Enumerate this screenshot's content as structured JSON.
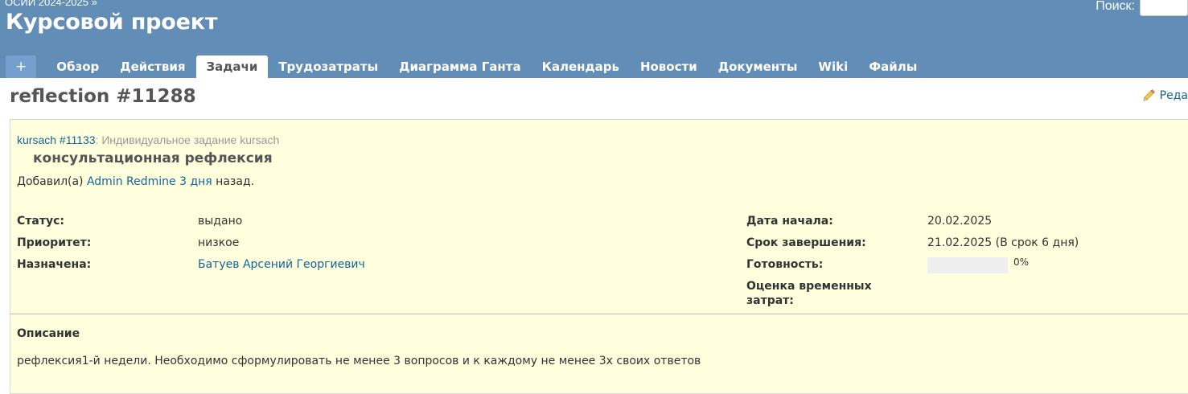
{
  "header": {
    "parent_project": "ОСИИ 2024-2025 »",
    "project_title": "Курсовой проект",
    "search_label": "Поиск:",
    "search_value": ""
  },
  "tabs": [
    {
      "label": "+",
      "selected": false
    },
    {
      "label": "Обзор",
      "selected": false
    },
    {
      "label": "Действия",
      "selected": false
    },
    {
      "label": "Задачи",
      "selected": true
    },
    {
      "label": "Трудозатраты",
      "selected": false
    },
    {
      "label": "Диаграмма Ганта",
      "selected": false
    },
    {
      "label": "Календарь",
      "selected": false
    },
    {
      "label": "Новости",
      "selected": false
    },
    {
      "label": "Документы",
      "selected": false
    },
    {
      "label": "Wiki",
      "selected": false
    },
    {
      "label": "Файлы",
      "selected": false
    }
  ],
  "issue": {
    "title": "reflection #11288",
    "edit_label": "Реда",
    "edit_icon": "pencil-icon",
    "parent_link": "kursach #11133",
    "parent_suffix": ": Индивидуальное задание kursach",
    "subject": "консультационная рефлексия",
    "author_prefix": "Добавил(а) ",
    "author": "Admin Redmine",
    "author_space": " ",
    "time_ago": "3 дня",
    "author_suffix": " назад.",
    "attributes_left": [
      {
        "label": "Статус:",
        "value": "выдано",
        "is_link": false
      },
      {
        "label": "Приоритет:",
        "value": "низкое",
        "is_link": false
      },
      {
        "label": "Назначена:",
        "value": "Батуев Арсений Георгиевич",
        "is_link": true
      }
    ],
    "start_date_label": "Дата начала:",
    "start_date": "20.02.2025",
    "due_date_label": "Срок завершения:",
    "due_date": "21.02.2025 (В срок 6 дня)",
    "done_ratio_label": "Готовность:",
    "done_ratio": 0,
    "done_ratio_text": "0%",
    "estimated_label": "Оценка временных затрат:",
    "estimated_value": "",
    "description_heading": "Описание",
    "description_text": "рефлексия1-й недели. Необходимо сформулировать не менее 3 вопросов и к каждому не менее 3х своих ответов"
  },
  "colors": {
    "header_bg": "#628db6",
    "tab_new_bg": "#759fcf",
    "issue_bg": "#ffffdd",
    "link": "#116699",
    "progress_track": "#eeeeee"
  }
}
